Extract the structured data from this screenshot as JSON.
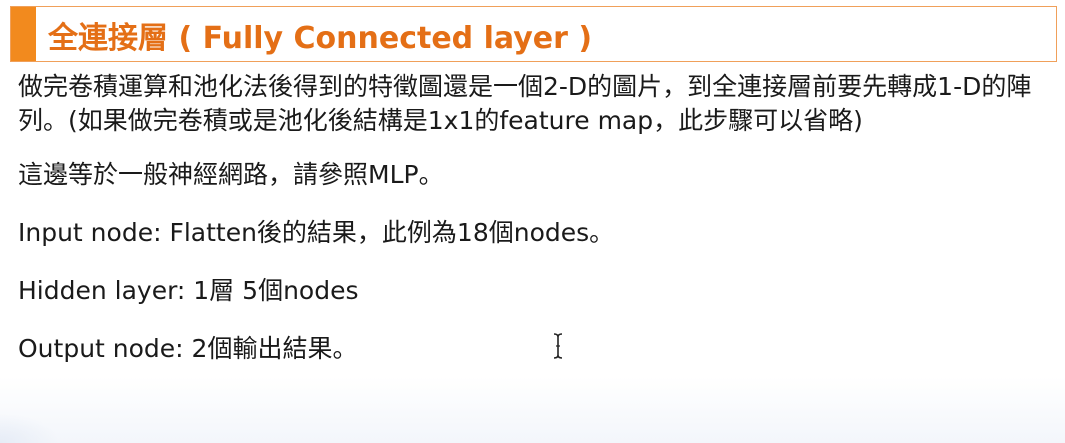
{
  "slide": {
    "title": "全連接層 ( Fully Connected layer )",
    "paragraph": "做完卷積運算和池化法後得到的特徵圖還是一個2-D的圖片，到全連接層前要先轉成1-D的陣列。(如果做完卷積或是池化後結構是1x1的feature map，此步驟可以省略)",
    "line_mlp": "這邊等於一般神經網路，請參照MLP。",
    "line_input": "Input node: Flatten後的結果，此例為18個nodes。",
    "line_hidden": "Hidden layer: 1層 5個nodes",
    "line_output": "Output node: 2個輸出結果。"
  },
  "colors": {
    "accent": "#f28a1e",
    "title_text": "#e46f16",
    "title_border": "#f0a05a"
  },
  "icons": {
    "cursor": "text-cursor-icon"
  }
}
